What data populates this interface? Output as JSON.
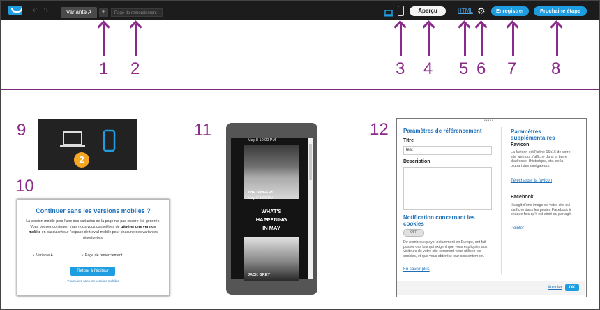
{
  "toolbar": {
    "tab_label": "Variante A",
    "add_tab": "+",
    "page_placeholder": "Page de remerciement",
    "preview_label": "Aperçu",
    "html_label": "HTML",
    "save_label": "Enregistrer",
    "next_label": "Prochaine étape"
  },
  "callouts": [
    "1",
    "2",
    "3",
    "4",
    "5",
    "6",
    "7",
    "8",
    "9",
    "10",
    "11",
    "12"
  ],
  "panel9": {
    "badge": "2"
  },
  "panel10": {
    "title": "Continuer sans les versions mobiles ?",
    "line1": "La version mobile pour l'une des variantes de la page n'a pas encore été générée.",
    "line2a": "Vous pouvez continuer, mais nous vous conseillons de ",
    "line2b": "générer une version mobile",
    "line2c": " en basculant sur l'espace de travail mobile pour chacune des variantes répertoriées.",
    "items": [
      "Variante A",
      "Page de remerciement"
    ],
    "button": "Retour à l'éditeur",
    "link": "Poursuivre sans les versions mobiles"
  },
  "panel11": {
    "date1": "May 8   10:00 PM",
    "band": "THE SINGERS",
    "date2": "May 3   8:00 PM",
    "headline1": "WHAT'S",
    "headline2": "HAPPENING",
    "headline3": "IN MAY",
    "artist": "JACK GREY"
  },
  "panel12": {
    "seo_title": "Paramètres de référencement",
    "title_label": "Titre",
    "title_value": "test",
    "desc_label": "Description",
    "cookie_title": "Notification concernant les cookies",
    "toggle": "OFF",
    "cookie_text": "De nombreux pays, notamment en Europe, ont fait passer des lois qui exigent que vous expliquiez aux visiteurs de votre site comment vous utilisez les cookies, et que vous obteniez leur consentement.",
    "learn_more": "En savoir plus",
    "extra_title": "Paramètres supplémentaires",
    "favicon_label": "Favicon",
    "favicon_text": "La favicon est l'icône 16x16 de votre site web qui s'affiche dans la barre d'adresse, l'historique, etc. de la plupart des navigateurs.",
    "favicon_link": "Télécharger la favicon",
    "facebook_label": "Facebook",
    "facebook_text": "Il s'agit d'une image de votre site qui s'affiche dans les postes Facebook à chaque fois qu'il est aimé ou partagé.",
    "facebook_link": "Pointer",
    "cancel": "Annuler",
    "ok": "OK"
  },
  "colors": {
    "accent": "#1e9de0",
    "callout": "#8a2a8a",
    "toolbar_bg": "#1c1c1c"
  }
}
